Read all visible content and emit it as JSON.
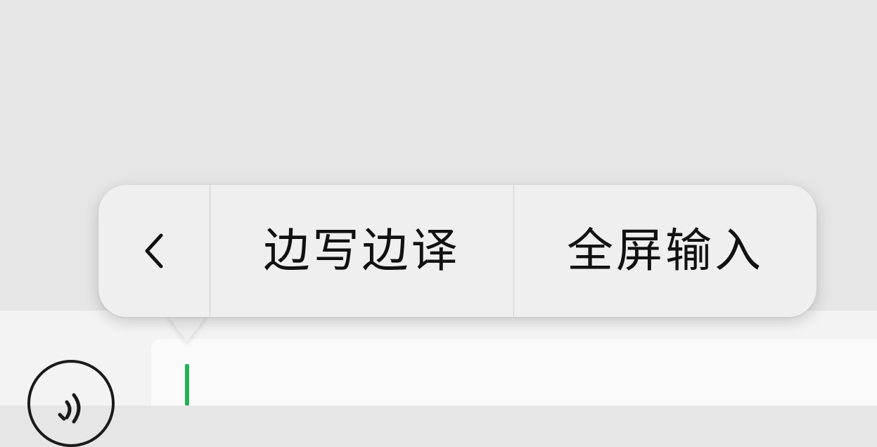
{
  "popover_menu": {
    "back_icon": "chevron-left-icon",
    "items": [
      {
        "label": "边写边译"
      },
      {
        "label": "全屏输入"
      }
    ]
  },
  "input_bar": {
    "voice_icon": "voice-input-icon",
    "cursor_color": "#22b157"
  },
  "colors": {
    "background": "#e6e6e6",
    "popover": "#efefef",
    "input_field": "#fafafa"
  }
}
